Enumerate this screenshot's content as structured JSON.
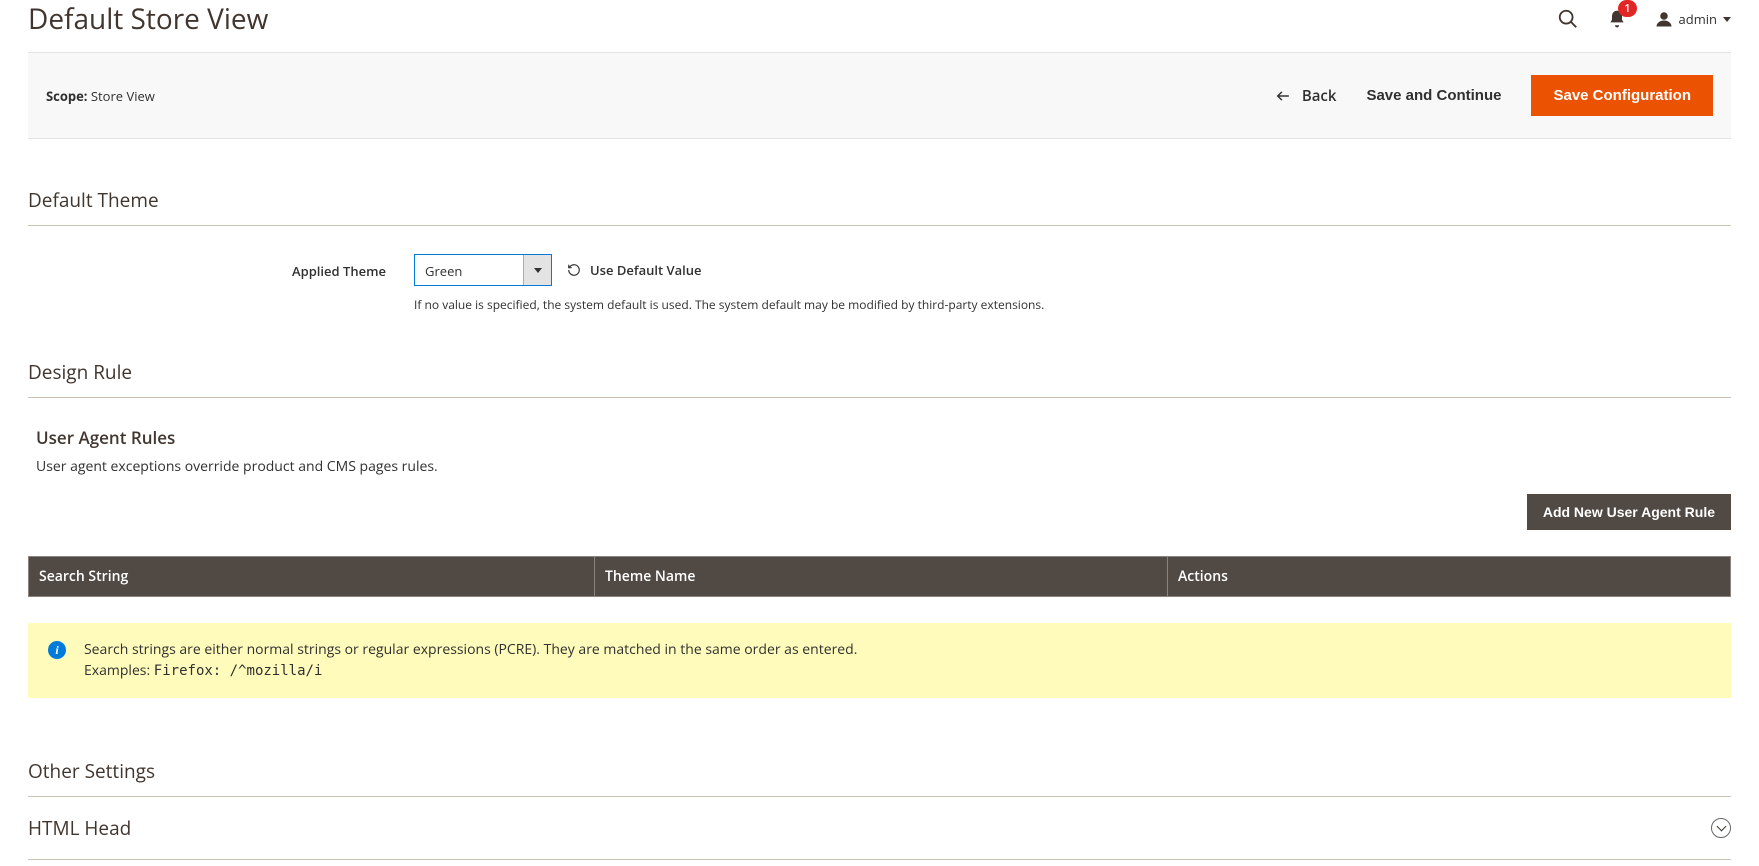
{
  "header": {
    "page_title": "Default Store View",
    "notification_count": "1",
    "admin_label": "admin"
  },
  "action_bar": {
    "scope_label": "Scope:",
    "scope_value": "Store View",
    "back_label": "Back",
    "save_continue_label": "Save and Continue",
    "save_config_label": "Save Configuration"
  },
  "sections": {
    "default_theme": {
      "title": "Default Theme",
      "applied_theme_label": "Applied Theme",
      "applied_theme_value": "Green",
      "use_default_label": "Use Default Value",
      "note": "If no value is specified, the system default is used. The system default may be modified by third-party extensions."
    },
    "design_rule": {
      "title": "Design Rule",
      "user_agent_title": "User Agent Rules",
      "user_agent_note": "User agent exceptions override product and CMS pages rules.",
      "add_rule_label": "Add New User Agent Rule",
      "columns": {
        "search_string": "Search String",
        "theme_name": "Theme Name",
        "actions": "Actions"
      },
      "info_line1": "Search strings are either normal strings or regular expressions (PCRE). They are matched in the same order as entered.",
      "info_examples_prefix": "Examples: ",
      "info_examples_code": "Firefox: /^mozilla/i"
    },
    "other_settings": {
      "title": "Other Settings",
      "html_head": "HTML Head"
    }
  }
}
